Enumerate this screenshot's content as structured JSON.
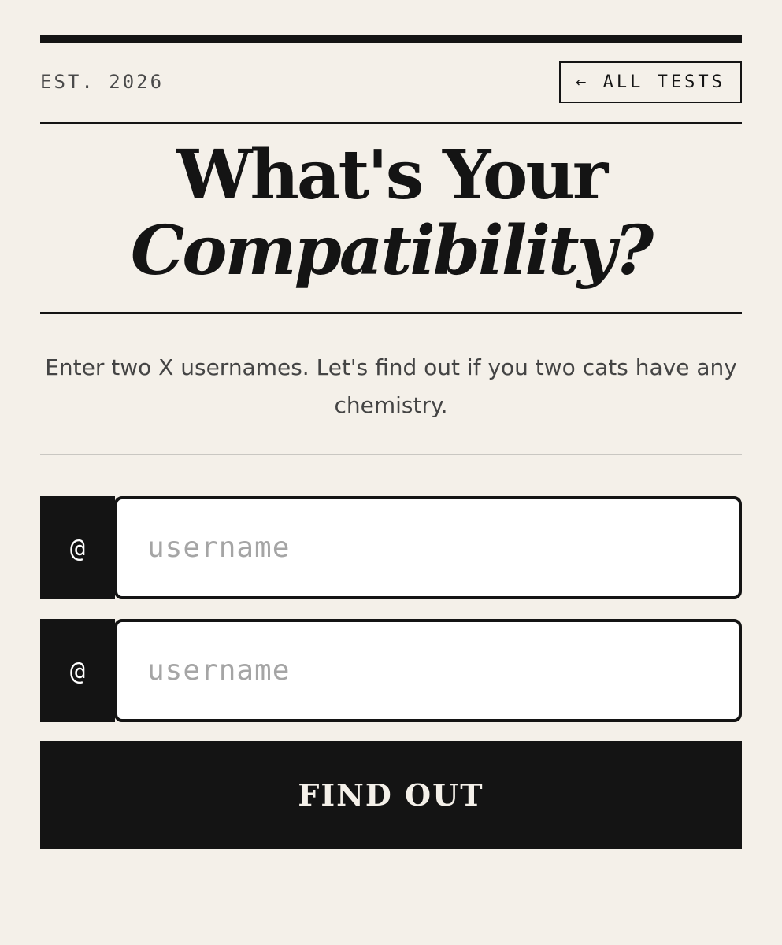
{
  "header": {
    "est_label": "EST. 2026",
    "back_button_label": "← ALL TESTS"
  },
  "hero": {
    "title_line1": "What's Your",
    "title_line2": "Compatibility?"
  },
  "intro": {
    "text": "Enter two X usernames. Let's find out if you two cats have any chemistry."
  },
  "form": {
    "fields": [
      {
        "prefix": "@",
        "value": "",
        "placeholder": "username"
      },
      {
        "prefix": "@",
        "value": "",
        "placeholder": "username"
      }
    ],
    "submit_label": "FIND OUT"
  }
}
